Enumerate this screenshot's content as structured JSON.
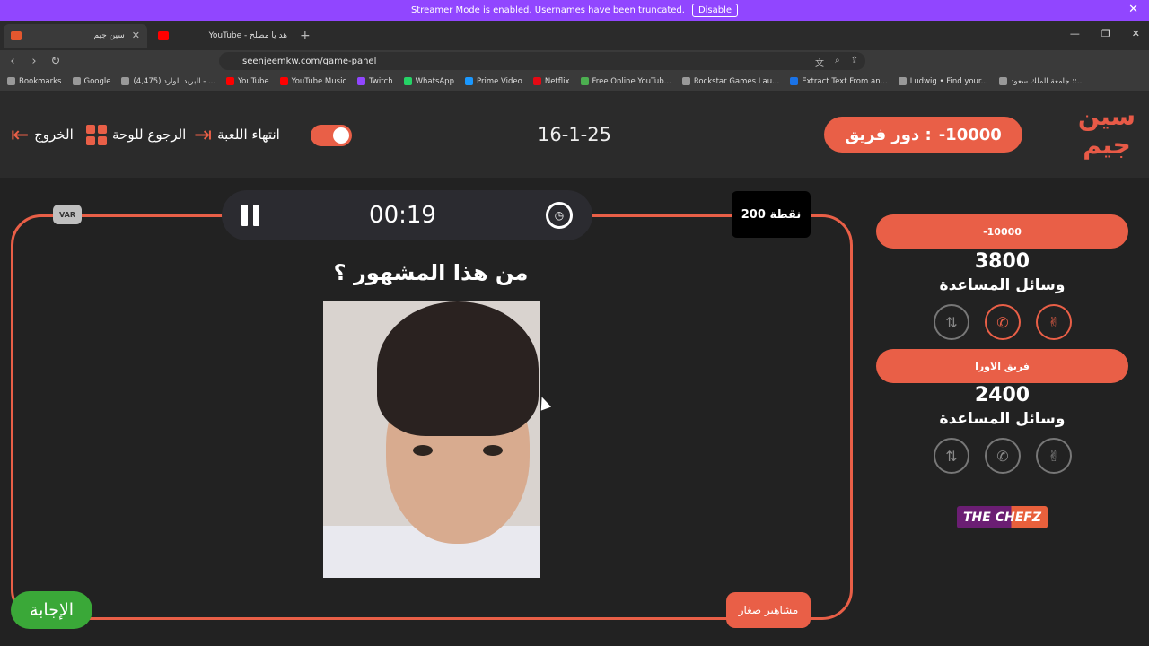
{
  "streamer_banner": {
    "text": "Streamer Mode is enabled. Usernames have been truncated.",
    "button": "Disable"
  },
  "tabs": [
    {
      "title": "سين جيم",
      "active": true
    },
    {
      "title": "YouTube - هد يا مصلح",
      "active": false
    }
  ],
  "url": "seenjeemkw.com/game-panel",
  "bookmarks": [
    "Bookmarks",
    "Google",
    "(4,475) البريد الوارد - ...",
    "YouTube",
    "YouTube Music",
    "Twitch",
    "WhatsApp",
    "Prime Video",
    "Netflix",
    "Free Online YouTub...",
    "Rockstar Games Lau...",
    "Extract Text From an...",
    "Ludwig • Find your...",
    "جامعة الملك سعود ::..."
  ],
  "header": {
    "logo_text": "سين جيم",
    "turn_label": "دور فريق :",
    "turn_value": "-10000",
    "date": "16-1-25",
    "end_game": "انتهاء اللعبة",
    "back_to_board": "الرجوع للوحة",
    "exit": "الخروج"
  },
  "timer": {
    "time": "00:19"
  },
  "var_badge": "VAR",
  "points": "200 نقطة",
  "question": "من هذا المشهور ؟",
  "answer_button": "الإجابة",
  "category": "مشاهير صغار",
  "teams": [
    {
      "name": "-10000",
      "score": "3800",
      "aids_label": "وسائل المساعدة",
      "aids_active": true
    },
    {
      "name": "فريق الاورا",
      "score": "2400",
      "aids_label": "وسائل المساعدة",
      "aids_active": false
    }
  ],
  "sponsor": "THE CHEFZ",
  "colors": {
    "accent": "#e95f47",
    "answer": "#3aa838",
    "streamer": "#9146ff"
  }
}
